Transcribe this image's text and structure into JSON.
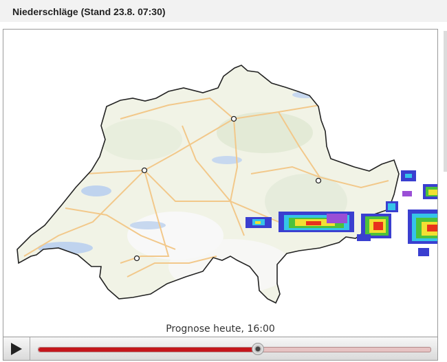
{
  "header": {
    "title": "Niederschläge (Stand 23.8. 07:30)"
  },
  "map": {
    "caption": "Prognose heute, 16:00"
  },
  "player": {
    "play_icon": "play-icon",
    "progress_fraction": 0.56,
    "colors": {
      "fill": "#c4161c",
      "track": "#e6c3c3"
    }
  }
}
